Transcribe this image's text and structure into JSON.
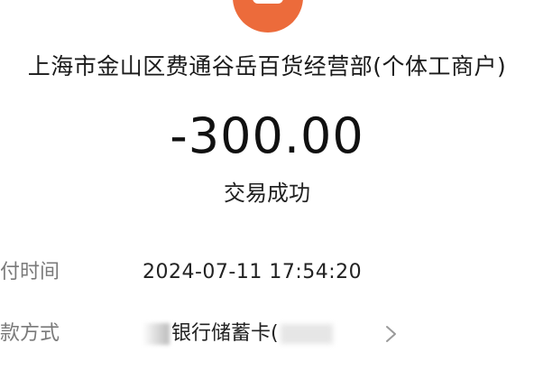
{
  "merchant": {
    "logo_icon": "merchant-logo-icon",
    "logo_color": "#ec6b3b",
    "name": "上海市金山区费通谷岳百货经营部(个体工商户)"
  },
  "transaction": {
    "amount": "-300.00",
    "status": "交易成功"
  },
  "details": {
    "payment_time_label": "付时间",
    "payment_time_value": "2024-07-11 17:54:20",
    "payment_method_label": "款方式",
    "payment_method_value": "银行储蓄卡(",
    "payment_method_chevron_icon": "chevron-right-icon"
  },
  "colors": {
    "label": "#7a7a7a",
    "text": "#111111"
  }
}
